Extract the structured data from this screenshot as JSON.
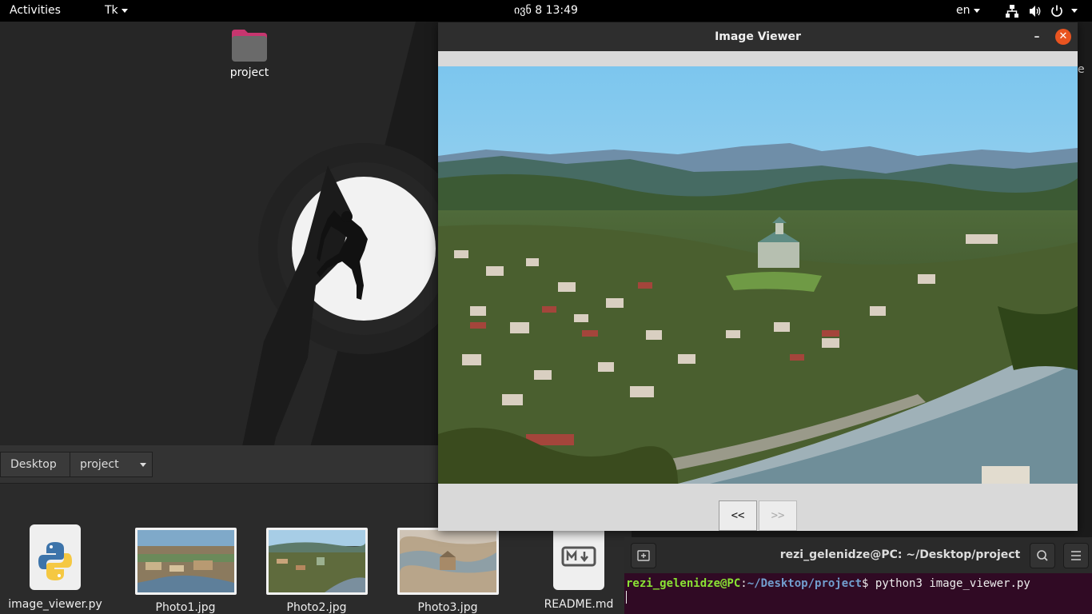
{
  "topbar": {
    "activities": "Activities",
    "app_menu": "Tk",
    "clock": "ივნ 8  13:49",
    "language": "en",
    "icons": [
      "network-icon",
      "volume-icon",
      "power-icon"
    ]
  },
  "desktop": {
    "folder_label": "project",
    "edge_text": "e"
  },
  "file_manager": {
    "breadcrumb": [
      "Desktop",
      "project"
    ],
    "files": [
      {
        "name": "image_viewer.py",
        "icon": "python-file-icon"
      },
      {
        "name": "Photo1.jpg",
        "icon": "image-thumbnail"
      },
      {
        "name": "Photo2.jpg",
        "icon": "image-thumbnail"
      },
      {
        "name": "Photo3.jpg",
        "icon": "image-thumbnail"
      },
      {
        "name": "README.md",
        "icon": "markdown-file-icon"
      }
    ]
  },
  "viewer": {
    "title": "Image Viewer",
    "minimize": "–",
    "close": "✕",
    "prev_label": "<<",
    "next_label": ">>",
    "next_enabled": false
  },
  "terminal": {
    "title": "rezi_gelenidze@PC: ~/Desktop/project",
    "prompt_user": "rezi_gelenidze@PC",
    "prompt_sep": ":",
    "prompt_path": "~/Desktop/project",
    "prompt_end": "$ ",
    "command": "python3 image_viewer.py"
  },
  "colors": {
    "accent": "#e95420",
    "terminal_bg": "#300a24",
    "prompt_user": "#8ae234",
    "prompt_path": "#729fcf"
  }
}
